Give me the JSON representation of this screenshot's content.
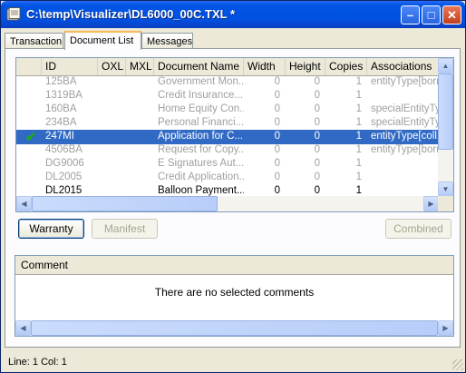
{
  "window": {
    "title": "C:\\temp\\Visualizer\\DL6000_00C.TXL *",
    "minimize": "–",
    "maximize": "□",
    "close": "✕"
  },
  "tabs": [
    "Transaction",
    "Document List",
    "Messages"
  ],
  "active_tab": "Document List",
  "grid": {
    "columns": [
      "ID",
      "OXL",
      "MXL",
      "Document Name",
      "Width",
      "Height",
      "Copies",
      "Associations"
    ],
    "rows": [
      {
        "id": "125BA",
        "name": "Government Mon...",
        "width": "0",
        "height": "0",
        "copies": "1",
        "assoc": "entityType[borr"
      },
      {
        "id": "1319BA",
        "name": "Credit Insurance...",
        "width": "0",
        "height": "0",
        "copies": "1",
        "assoc": ""
      },
      {
        "id": "160BA",
        "name": "Home  Equity Con...",
        "width": "0",
        "height": "0",
        "copies": "1",
        "assoc": "specialEntityTy"
      },
      {
        "id": "234BA",
        "name": "Personal Financi...",
        "width": "0",
        "height": "0",
        "copies": "1",
        "assoc": "specialEntityTy"
      },
      {
        "id": "247MI",
        "name": "Application for C...",
        "width": "0",
        "height": "0",
        "copies": "1",
        "assoc": "entityType[coll"
      },
      {
        "id": "4506BA",
        "name": "Request for Copy...",
        "width": "0",
        "height": "0",
        "copies": "1",
        "assoc": "entityType[borr"
      },
      {
        "id": "DG9006",
        "name": "E Signatures Aut...",
        "width": "0",
        "height": "0",
        "copies": "1",
        "assoc": ""
      },
      {
        "id": "DL2005",
        "name": "Credit Application...",
        "width": "0",
        "height": "0",
        "copies": "1",
        "assoc": ""
      },
      {
        "id": "DL2015",
        "name": "Balloon  Payment...",
        "width": "0",
        "height": "0",
        "copies": "1",
        "assoc": ""
      }
    ],
    "selected_row": 4,
    "selected_marker": "✔"
  },
  "buttons": {
    "warranty": "Warranty",
    "manifest": "Manifest",
    "combined": "Combined"
  },
  "comment": {
    "header": "Comment",
    "empty_text": "There are no selected comments"
  },
  "status": {
    "text": "Line: 1  Col: 1"
  },
  "colors": {
    "title_bar": "#0055e5",
    "selection": "#316ac5",
    "check": "#1da71d"
  }
}
